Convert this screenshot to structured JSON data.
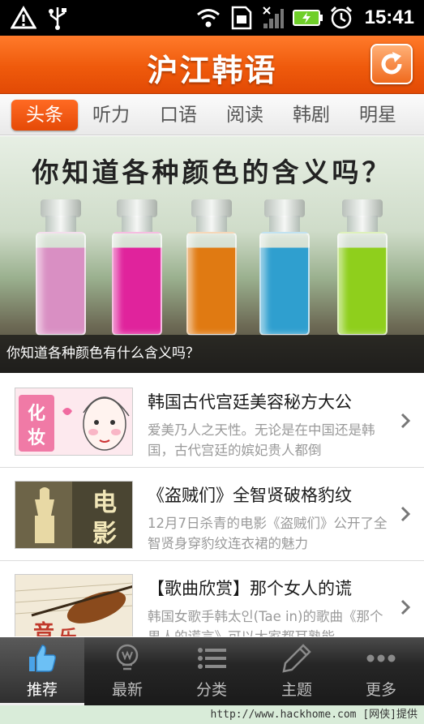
{
  "status_bar": {
    "time": "15:41",
    "icons": [
      "signal-warning-icon",
      "usb-icon",
      "wifi-icon",
      "sim-icon",
      "cellular-signal-icon",
      "battery-icon",
      "alarm-clock-icon"
    ]
  },
  "header": {
    "title": "沪江韩语",
    "refresh_icon": "refresh-icon"
  },
  "tabs": [
    {
      "label": "头条",
      "active": true
    },
    {
      "label": "听力"
    },
    {
      "label": "口语"
    },
    {
      "label": "阅读"
    },
    {
      "label": "韩剧"
    },
    {
      "label": "明星"
    }
  ],
  "banner": {
    "headline": "你知道各种颜色的含义吗？",
    "caption": "你知道各种颜色有什么含义吗？",
    "vial_colors": [
      "#d98fc3",
      "#e0239c",
      "#e07a12",
      "#2f9fcf",
      "#8fcf1c"
    ]
  },
  "articles": [
    {
      "title": "韩国古代宫廷美容秘方大公",
      "desc": "爱美乃人之天性。无论是在中国还是韩国，古代宫廷的嫔妃贵人都倒",
      "thumb_text": [
        "化",
        "妆"
      ]
    },
    {
      "title": "《盗贼们》全智贤破格豹纹",
      "desc": "12月7日杀青的电影《盗贼们》公开了全智贤身穿豹纹连衣裙的魅力",
      "thumb_text": [
        "电",
        "影"
      ]
    },
    {
      "title": "【歌曲欣赏】那个女人的谎",
      "desc": "韩国女歌手韩太인(Tae in)的歌曲《那个男人的谎言》可以大家都耳熟能",
      "thumb_text": [
        "音",
        "乐"
      ]
    }
  ],
  "bottom_nav": [
    {
      "label": "推荐",
      "icon": "thumbs-up-icon",
      "active": true
    },
    {
      "label": "最新",
      "icon": "lightbulb-icon"
    },
    {
      "label": "分类",
      "icon": "list-icon"
    },
    {
      "label": "主题",
      "icon": "pencil-icon"
    },
    {
      "label": "更多",
      "icon": "more-dots-icon"
    }
  ],
  "watermark": "http://www.hackhome.com [网侠]提供"
}
